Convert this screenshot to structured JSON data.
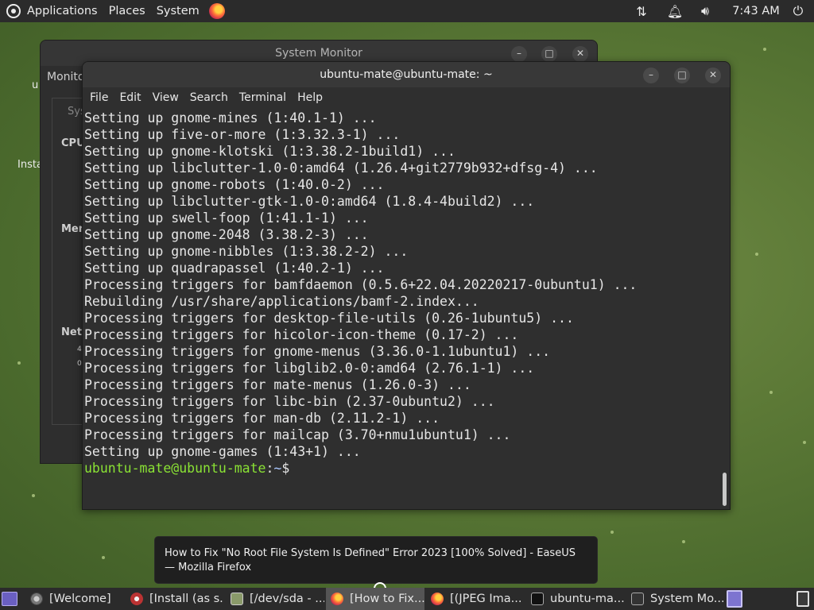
{
  "top_panel": {
    "menus": [
      "Applications",
      "Places",
      "System"
    ],
    "clock": "7:43 AM",
    "icons": [
      "ubuntu-mate-logo-icon",
      "firefox-icon",
      "network-icon",
      "notification-bell-icon",
      "volume-icon",
      "power-icon"
    ]
  },
  "system_monitor": {
    "title": "System Monitor",
    "tab_fragment": "Monito",
    "sys_fragment": "Sys",
    "sections": [
      "CPU",
      "Mem",
      "Net"
    ],
    "net_digits": [
      "4",
      "0"
    ]
  },
  "desktop": {
    "fragment_u": "u",
    "fragment_install": "Insta"
  },
  "terminal": {
    "title": "ubuntu-mate@ubuntu-mate: ~",
    "menu": [
      "File",
      "Edit",
      "View",
      "Search",
      "Terminal",
      "Help"
    ],
    "lines": [
      "Setting up gnome-mines (1:40.1-1) ...",
      "Setting up five-or-more (1:3.32.3-1) ...",
      "Setting up gnome-klotski (1:3.38.2-1build1) ...",
      "Setting up libclutter-1.0-0:amd64 (1.26.4+git2779b932+dfsg-4) ...",
      "Setting up gnome-robots (1:40.0-2) ...",
      "Setting up libclutter-gtk-1.0-0:amd64 (1.8.4-4build2) ...",
      "Setting up swell-foop (1:41.1-1) ...",
      "Setting up gnome-2048 (3.38.2-3) ...",
      "Setting up gnome-nibbles (1:3.38.2-2) ...",
      "Setting up quadrapassel (1:40.2-1) ...",
      "Processing triggers for bamfdaemon (0.5.6+22.04.20220217-0ubuntu1) ...",
      "Rebuilding /usr/share/applications/bamf-2.index...",
      "Processing triggers for desktop-file-utils (0.26-1ubuntu5) ...",
      "Processing triggers for hicolor-icon-theme (0.17-2) ...",
      "Processing triggers for gnome-menus (3.36.0-1.1ubuntu1) ...",
      "Processing triggers for libglib2.0-0:amd64 (2.76.1-1) ...",
      "Processing triggers for mate-menus (1.26.0-3) ...",
      "Processing triggers for libc-bin (2.37-0ubuntu2) ...",
      "Processing triggers for man-db (2.11.2-1) ...",
      "Processing triggers for mailcap (3.70+nmu1ubuntu1) ...",
      "Setting up gnome-games (1:43+1) ..."
    ],
    "prompt_user": "ubuntu-mate@ubuntu-mate",
    "prompt_sep": ":",
    "prompt_path": "~",
    "prompt_symbol": "$"
  },
  "tooltip": {
    "text": "How to Fix \"No Root File System Is Defined\" Error 2023 [100% Solved] - EaseUS — Mozilla Firefox"
  },
  "taskbar": {
    "tasks": [
      {
        "label": "[Welcome]",
        "icon": "welcome-icon"
      },
      {
        "label": "[Install (as s...",
        "icon": "installer-icon"
      },
      {
        "label": "[/dev/sda - ...",
        "icon": "disk-icon"
      },
      {
        "label": "[How to Fix...",
        "icon": "firefox-icon"
      },
      {
        "label": "[(JPEG Ima...",
        "icon": "firefox-icon"
      },
      {
        "label": "ubuntu-ma...",
        "icon": "terminal-icon"
      },
      {
        "label": "System Mo...",
        "icon": "system-monitor-icon"
      }
    ]
  }
}
